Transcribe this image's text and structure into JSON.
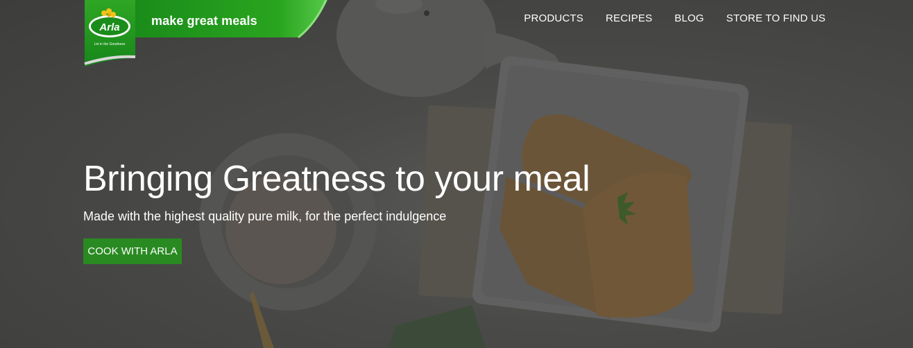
{
  "brand": {
    "logo_text": "Arla",
    "logo_subtext": "Let in the Goodness",
    "tagline": "make great meals"
  },
  "nav": {
    "items": [
      {
        "label": "PRODUCTS"
      },
      {
        "label": "RECIPES"
      },
      {
        "label": "BLOG"
      },
      {
        "label": "STORE TO FIND US"
      }
    ]
  },
  "hero": {
    "headline": "Bringing Greatness to your meal",
    "subline": "Made with the highest quality pure milk, for the perfect indulgence",
    "cta_label": "COOK WITH ARLA"
  },
  "colors": {
    "brand_green": "#1f9a1c",
    "button_green": "#2a8a22",
    "overlay": "#444443"
  }
}
